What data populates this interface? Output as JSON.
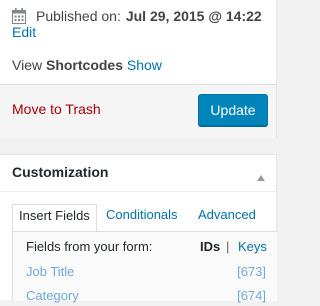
{
  "publish": {
    "published_label": "Published on:",
    "published_date": "Jul 29, 2015 @ 14:22",
    "edit_label": "Edit",
    "shortcodes_prefix": "View ",
    "shortcodes_bold": "Shortcodes",
    "shortcodes_link": "Show",
    "trash_label": "Move to Trash",
    "update_label": "Update"
  },
  "customization": {
    "title": "Customization",
    "tabs": [
      {
        "label": "Insert Fields",
        "active": true
      },
      {
        "label": "Conditionals",
        "active": false
      },
      {
        "label": "Advanced",
        "active": false
      }
    ],
    "fields_label": "Fields from your form:",
    "ids_label": "IDs",
    "separator": "|",
    "keys_label": "Keys",
    "fields": [
      {
        "name": "Job Title",
        "id": "[673]"
      },
      {
        "name": "Category",
        "id": "[674]"
      }
    ]
  },
  "colors": {
    "accent": "#0085ba",
    "link": "#0073aa",
    "danger": "#a00"
  },
  "icons": {
    "calendar": "calendar-icon",
    "toggle": "triangle-up-icon"
  }
}
